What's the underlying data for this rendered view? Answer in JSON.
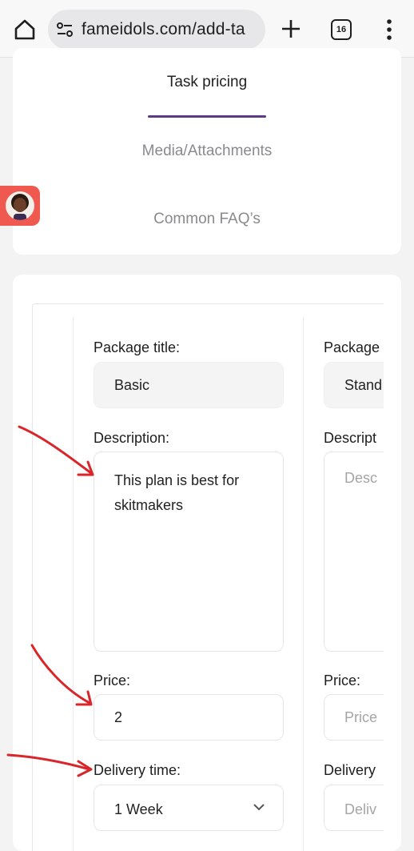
{
  "browser": {
    "url": "fameidols.com/add-ta",
    "tab_count": "16",
    "icons": [
      "home-icon",
      "site-settings-icon",
      "new-tab-icon",
      "tab-switcher-icon",
      "more-vert-icon"
    ]
  },
  "steps": {
    "active": "Task pricing",
    "media": "Media/Attachments",
    "faq": "Common FAQ’s",
    "accent_color": "#5b3a86"
  },
  "packages": {
    "basic": {
      "title_label": "Package title:",
      "title_value": "Basic",
      "description_label": "Description:",
      "description_value": "This plan is best for skitmakers",
      "price_label": "Price:",
      "price_value": "2",
      "delivery_label": "Delivery time:",
      "delivery_value": "1 Week"
    },
    "standard": {
      "title_label": "Package",
      "title_value": "Stand",
      "description_label": "Descript",
      "description_placeholder": "Desc",
      "price_label": "Price:",
      "price_placeholder": "Price",
      "delivery_label": "Delivery",
      "delivery_placeholder": "Deliv"
    }
  },
  "annotation_color": "#d8262a"
}
